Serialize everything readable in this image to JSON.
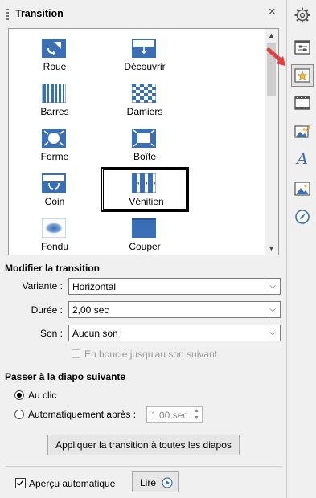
{
  "panel": {
    "title": "Transition",
    "close_glyph": "×"
  },
  "gallery": {
    "items": [
      {
        "label": "Roue",
        "icon": "wheel-transition-icon"
      },
      {
        "label": "Découvrir",
        "icon": "uncover-transition-icon"
      },
      {
        "label": "Barres",
        "icon": "bars-transition-icon"
      },
      {
        "label": "Damiers",
        "icon": "checkers-transition-icon"
      },
      {
        "label": "Forme",
        "icon": "shape-transition-icon"
      },
      {
        "label": "Boîte",
        "icon": "box-transition-icon"
      },
      {
        "label": "Coin",
        "icon": "corner-transition-icon"
      },
      {
        "label": "Vénitien",
        "icon": "venetian-transition-icon",
        "selected": true
      },
      {
        "label": "Fondu",
        "icon": "fade-transition-icon"
      },
      {
        "label": "Couper",
        "icon": "cut-transition-icon"
      }
    ],
    "scroll_up": "▲",
    "scroll_down": "▼"
  },
  "modify": {
    "heading": "Modifier la transition",
    "variant_label": "Variante :",
    "variant_value": "Horizontal",
    "duration_label": "Durée :",
    "duration_value": "2,00 sec",
    "sound_label": "Son :",
    "sound_value": "Aucun son",
    "loop_label": "En boucle jusqu'au son suivant",
    "dropdown_glyph": "⌵"
  },
  "advance": {
    "heading": "Passer à la diapo suivante",
    "on_click_label": "Au clic",
    "auto_label": "Automatiquement après :",
    "auto_value": "1,00 sec",
    "apply_all_label": "Appliquer la transition à toutes les diapos"
  },
  "footer": {
    "auto_preview_label": "Aperçu automatique",
    "play_label": "Lire"
  },
  "sidebar": {
    "icons": [
      "settings-icon",
      "properties-icon",
      "slide-transition-icon",
      "animation-icon",
      "gallery-image-icon",
      "styles-icon",
      "image-icon",
      "navigator-icon"
    ]
  },
  "colors": {
    "accent_blue": "#3b6fb5",
    "pointer_red": "#e04040"
  }
}
